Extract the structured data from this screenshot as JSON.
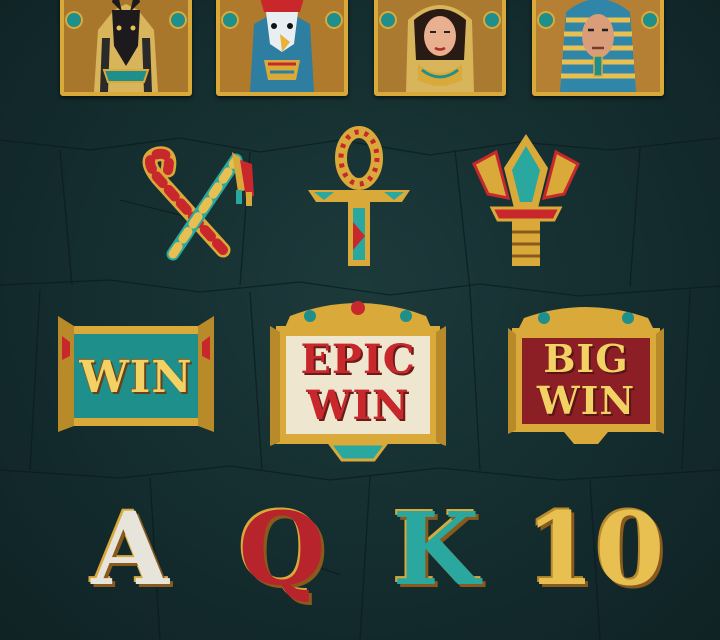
{
  "portraits": [
    {
      "name": "anubis",
      "colors": {
        "bg": "#a9772b",
        "face": "#1c1a1c",
        "headdress": "#d8b55a"
      }
    },
    {
      "name": "horus",
      "colors": {
        "bg": "#b07a2c",
        "face": "#e9eef2",
        "headdress": "#2d7ea0"
      }
    },
    {
      "name": "cleopatra",
      "colors": {
        "bg": "#a97a30",
        "face": "#e8b08e",
        "headdress": "#d8b55a"
      }
    },
    {
      "name": "pharaoh",
      "colors": {
        "bg": "#b58034",
        "face": "#d99d7a",
        "headdress": "#2f86a8"
      }
    }
  ],
  "symbols": [
    {
      "name": "crook-and-flail"
    },
    {
      "name": "ankh"
    },
    {
      "name": "lotus-scepter"
    }
  ],
  "win_panels": [
    {
      "name": "win",
      "line1": "WIN",
      "line2": "",
      "bg": "#1e8f8a"
    },
    {
      "name": "epic-win",
      "line1": "EPIC",
      "line2": "WIN",
      "bg": "#efe6cf"
    },
    {
      "name": "big-win",
      "line1": "BIG",
      "line2": "WIN",
      "bg": "#8b1f25"
    }
  ],
  "card_letters": [
    {
      "label": "A",
      "color": "#e7e4dc"
    },
    {
      "label": "Q",
      "color": "#b8242c"
    },
    {
      "label": "K",
      "color": "#2aa89f"
    },
    {
      "label": "10",
      "color": "#e8c052"
    }
  ],
  "colors": {
    "gold": "#d9a93a",
    "background": "#142d2f",
    "teal": "#1e8f8a",
    "red": "#b8242c"
  }
}
